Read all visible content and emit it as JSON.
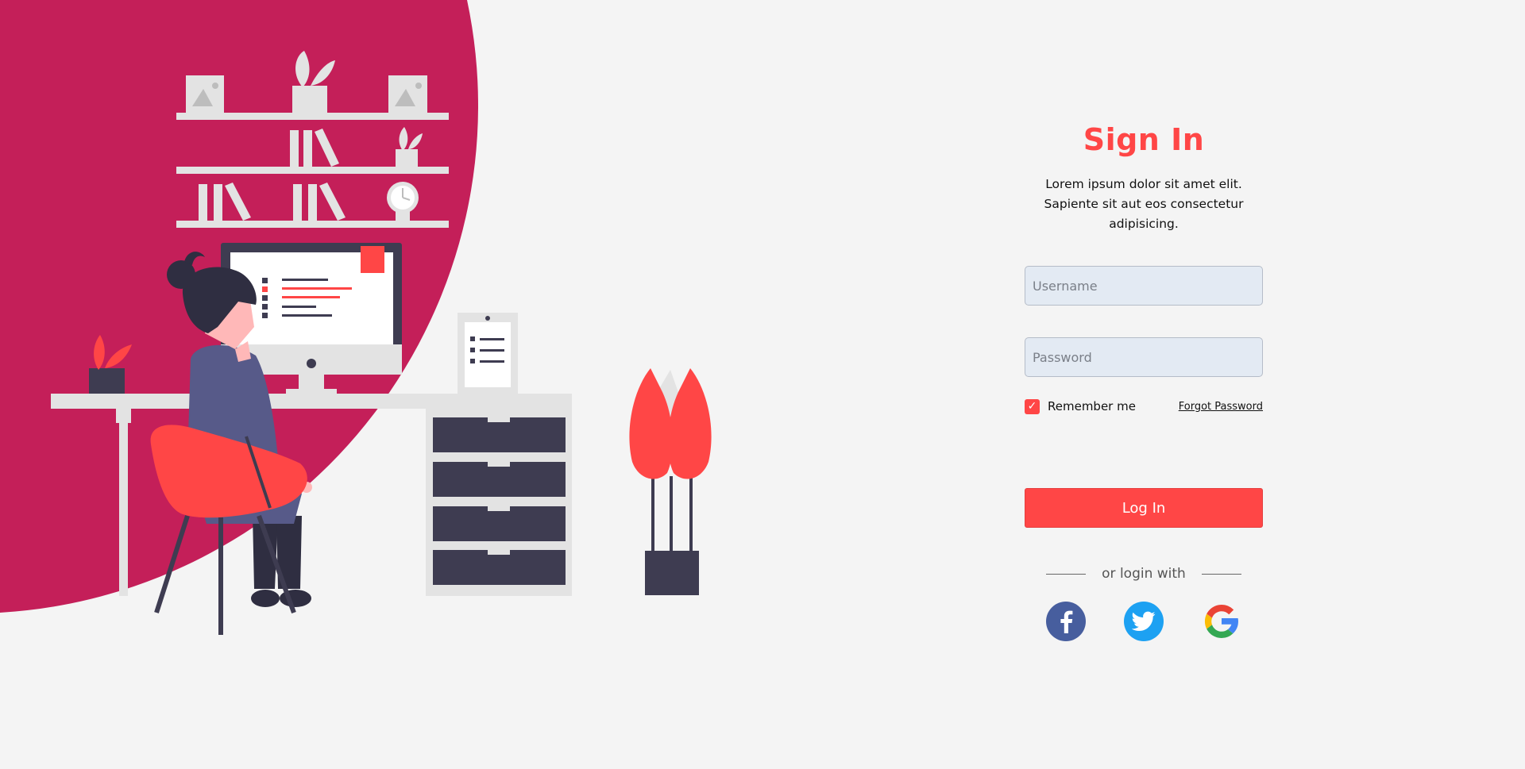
{
  "colors": {
    "accent": "#ff4646",
    "magenta": "#c41f59",
    "background": "#f4f4f4",
    "field_background": "#e3eaf3",
    "facebook": "#475e9e",
    "twitter": "#1da1f2"
  },
  "signin": {
    "title": "Sign In",
    "subtitle": "Lorem ipsum dolor sit amet elit. Sapiente sit aut eos consectetur adipisicing.",
    "username_placeholder": "Username",
    "password_placeholder": "Password",
    "remember_label": "Remember me",
    "remember_checked": true,
    "forgot_label": "Forgot Password",
    "login_label": "Log In",
    "divider_text": "or login with"
  },
  "social": [
    {
      "name": "facebook",
      "icon": "facebook-icon"
    },
    {
      "name": "twitter",
      "icon": "twitter-icon"
    },
    {
      "name": "google",
      "icon": "google-icon"
    }
  ]
}
